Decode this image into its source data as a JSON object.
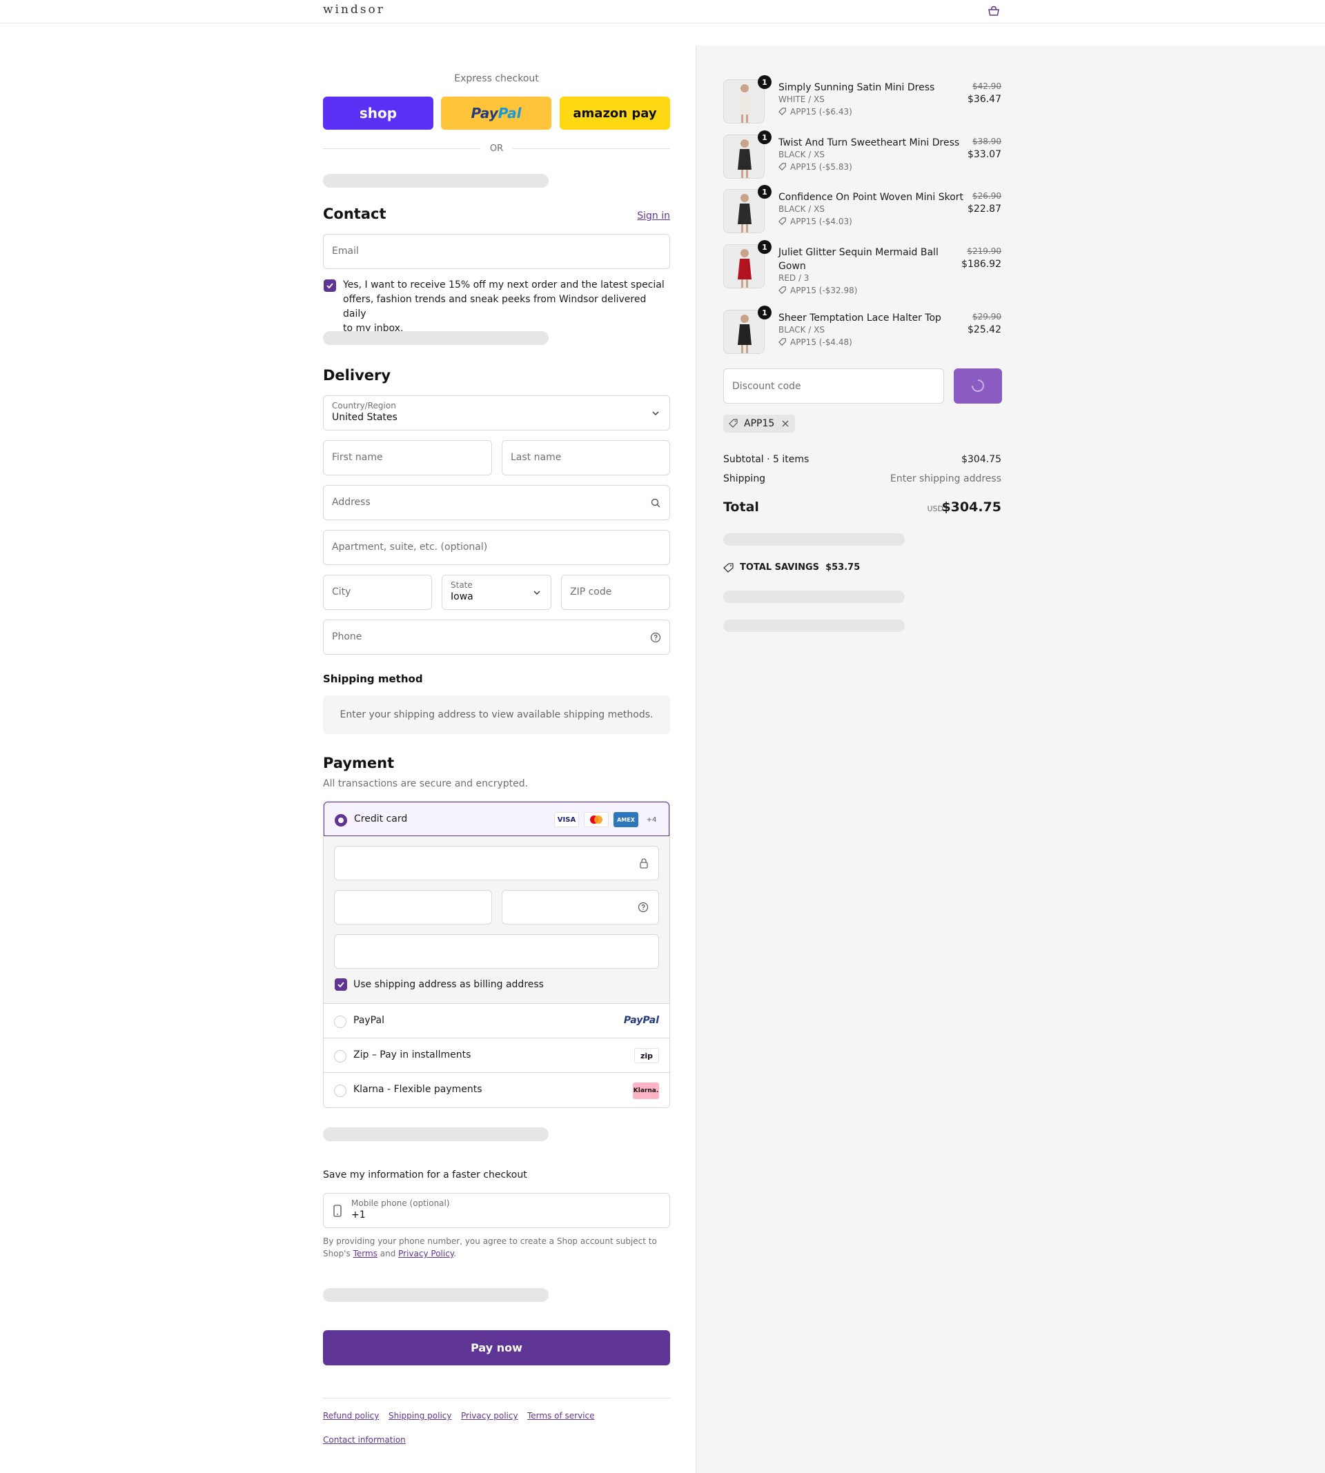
{
  "header": {
    "logo": "windsor"
  },
  "express": {
    "label": "Express checkout",
    "shop": "shop",
    "paypal_a": "Pay",
    "paypal_b": "Pal",
    "amazon": "amazon pay",
    "or": "OR"
  },
  "contact": {
    "title": "Contact",
    "sign_in": "Sign in",
    "email_placeholder": "Email",
    "newsletter_line1": "Yes, I want to receive 15% off my next order and the latest special",
    "newsletter_line2": "offers, fashion trends and sneak peeks from Windsor delivered daily",
    "newsletter_line3": "to my inbox."
  },
  "delivery": {
    "title": "Delivery",
    "country_label": "Country/Region",
    "country_value": "United States",
    "first_name": "First name",
    "last_name": "Last name",
    "address": "Address",
    "apartment": "Apartment, suite, etc. (optional)",
    "city": "City",
    "state_label": "State",
    "state_value": "Iowa",
    "zip": "ZIP code",
    "phone": "Phone"
  },
  "shipping": {
    "title": "Shipping method",
    "notice": "Enter your shipping address to view available shipping methods."
  },
  "payment": {
    "title": "Payment",
    "subtitle": "All transactions are secure and encrypted.",
    "credit_card": "Credit card",
    "brands": [
      "VISA",
      "AMEX",
      "+4"
    ],
    "billing_same": "Use shipping address as billing address",
    "paypal": "PayPal",
    "paypal_logo": "PayPal",
    "zip": "Zip – Pay in installments",
    "zip_logo": "zip",
    "klarna": "Klarna - Flexible payments",
    "klarna_logo": "Klarna."
  },
  "save_info": {
    "title": "Save my information for a faster checkout",
    "mobile_label": "Mobile phone (optional)",
    "mobile_value": "+1",
    "legal_1": "By providing your phone number, you agree to create a Shop account subject to",
    "legal_2a": "Shop's",
    "legal_terms": "Terms",
    "legal_and": "and",
    "legal_privacy": "Privacy Policy",
    "legal_end": "."
  },
  "pay_now": "Pay now",
  "footer": {
    "links": [
      "Refund policy",
      "Shipping policy",
      "Privacy policy",
      "Terms of service"
    ],
    "contact": "Contact information"
  },
  "order": {
    "items": [
      {
        "qty": "1",
        "name": "Simply Sunning Satin Mini Dress",
        "variant": "WHITE / XS",
        "discount": "APP15 (-$6.43)",
        "orig": "$42.90",
        "price": "$36.47",
        "color": "#efe9e4"
      },
      {
        "qty": "1",
        "name": "Twist And Turn Sweetheart Mini Dress",
        "variant": "BLACK / XS",
        "discount": "APP15 (-$5.83)",
        "orig": "$38.90",
        "price": "$33.07",
        "color": "#2a2a2a"
      },
      {
        "qty": "1",
        "name": "Confidence On Point Woven Mini Skort",
        "variant": "BLACK / XS",
        "discount": "APP15 (-$4.03)",
        "orig": "$26.90",
        "price": "$22.87",
        "color": "#2b2b2b"
      },
      {
        "qty": "1",
        "name": "Juliet Glitter Sequin Mermaid Ball Gown",
        "variant": "RED / 3",
        "discount": "APP15 (-$32.98)",
        "orig": "$219.90",
        "price": "$186.92",
        "color": "#b3121f"
      },
      {
        "qty": "1",
        "name": "Sheer Temptation Lace Halter Top",
        "variant": "BLACK / XS",
        "discount": "APP15 (-$4.48)",
        "orig": "$29.90",
        "price": "$25.42",
        "color": "#222222"
      }
    ],
    "discount_placeholder": "Discount code",
    "applied_code": "APP15",
    "subtotal_label": "Subtotal · 5 items",
    "subtotal_value": "$304.75",
    "shipping_label": "Shipping",
    "shipping_value": "Enter shipping address",
    "total_label": "Total",
    "currency": "USD",
    "total_value": "$304.75",
    "savings_label": "TOTAL SAVINGS",
    "savings_value": "$53.75"
  }
}
